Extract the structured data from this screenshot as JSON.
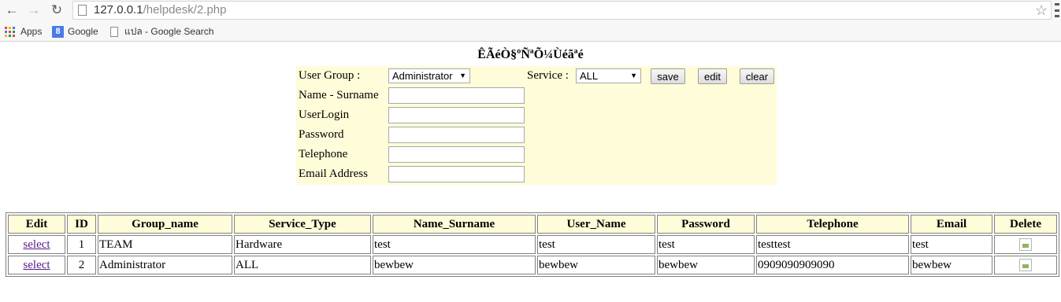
{
  "browser": {
    "url_host": "127.0.0.1",
    "url_path": "/helpdesk/2.php",
    "bookmarks": [
      {
        "label": "Apps"
      },
      {
        "label": "Google"
      },
      {
        "label": "แปล - Google Search"
      }
    ]
  },
  "page": {
    "title": "ÊÃéÒ§ºÑ­ªÕ¼Ùéãªé"
  },
  "form": {
    "user_group_label": "User Group :",
    "user_group_value": "Administrator",
    "service_label": "Service :",
    "service_value": "ALL",
    "save_label": "save",
    "edit_label": "edit",
    "clear_label": "clear",
    "name_label": "Name - Surname",
    "name_value": "",
    "userlogin_label": "UserLogin",
    "userlogin_value": "",
    "password_label": "Password",
    "password_value": "",
    "telephone_label": "Telephone",
    "telephone_value": "",
    "email_label": "Email Address",
    "email_value": ""
  },
  "table": {
    "headers": [
      "Edit",
      "ID",
      "Group_name",
      "Service_Type",
      "Name_Surname",
      "User_Name",
      "Password",
      "Telephone",
      "Email",
      "Delete"
    ],
    "rows": [
      {
        "edit": "select",
        "id": "1",
        "group": "TEAM",
        "service": "Hardware",
        "name": "test",
        "user": "test",
        "password": "test",
        "telephone": "testtest",
        "email": "test"
      },
      {
        "edit": "select",
        "id": "2",
        "group": "Administrator",
        "service": "ALL",
        "name": "bewbew",
        "user": "bewbew",
        "password": "bewbew",
        "telephone": "0909090909090",
        "email": "bewbew"
      }
    ]
  },
  "colors": {
    "panel_background": "#fffdd9",
    "link": "#551a8b"
  }
}
